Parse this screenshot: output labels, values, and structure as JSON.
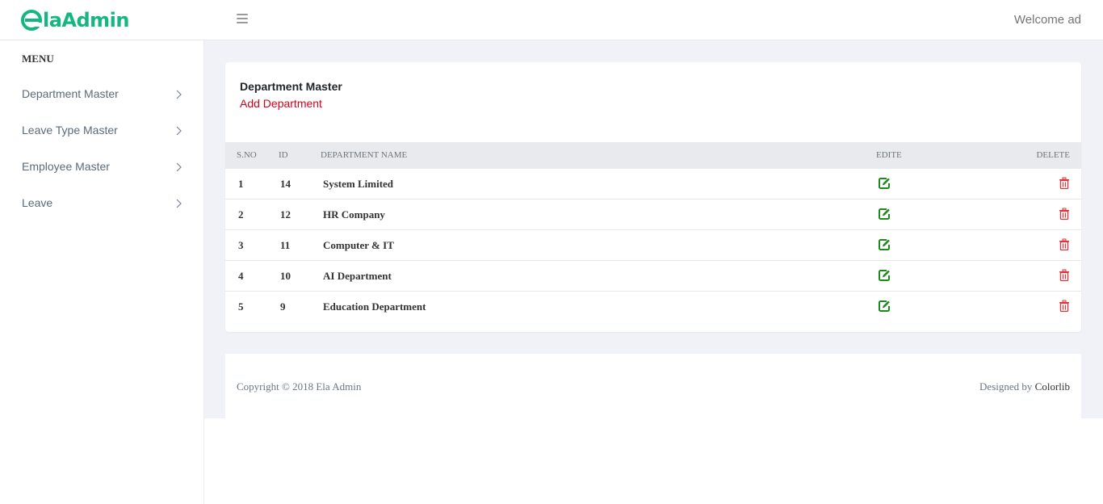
{
  "header": {
    "logo_text": "laAdmin",
    "logo_letter": "e",
    "welcome": "Welcome ad"
  },
  "sidebar": {
    "menu_title": "MENU",
    "items": [
      {
        "label": "Department Master"
      },
      {
        "label": "Leave Type Master"
      },
      {
        "label": "Employee Master"
      },
      {
        "label": "Leave"
      }
    ]
  },
  "card": {
    "title": "Department Master",
    "add_link": "Add Department"
  },
  "table": {
    "headers": {
      "sno": "S.NO",
      "id": "ID",
      "name": "DEPARTMENT NAME",
      "edit": "EDITE",
      "delete": "DELETE"
    },
    "rows": [
      {
        "sno": "1",
        "id": "14",
        "name": "System Limited"
      },
      {
        "sno": "2",
        "id": "12",
        "name": "HR Company"
      },
      {
        "sno": "3",
        "id": "11",
        "name": "Computer & IT"
      },
      {
        "sno": "4",
        "id": "10",
        "name": "AI Department"
      },
      {
        "sno": "5",
        "id": "9",
        "name": "Education Department"
      }
    ]
  },
  "footer": {
    "copyright": "Copyright © 2018 Ela Admin",
    "designed_prefix": "Designed by ",
    "designed_brand": "Colorlib"
  },
  "icons": {
    "logo": "ela-logo-icon",
    "hamburger": "hamburger-icon",
    "chevron": "chevron-right-icon",
    "edit": "edit-icon",
    "delete": "trash-icon"
  },
  "colors": {
    "brand": "#14b780",
    "link": "#d0021b",
    "edit": "#1e8a1e",
    "delete": "#e0343c",
    "content_bg": "#f1f2f7"
  }
}
